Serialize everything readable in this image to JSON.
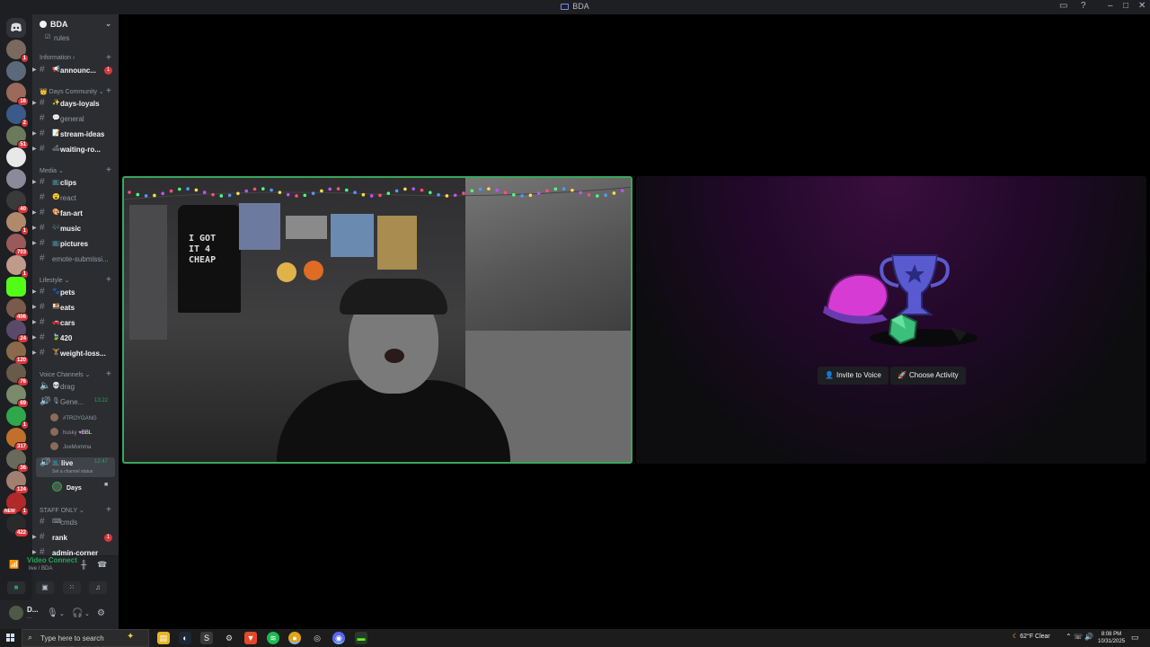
{
  "window": {
    "title": "BDA"
  },
  "server": {
    "name": "BDA"
  },
  "rail": {
    "servers": [
      {
        "name": "server-1",
        "badge": "1"
      },
      {
        "name": "server-2",
        "badge": ""
      },
      {
        "name": "server-3",
        "badge": "16"
      },
      {
        "name": "server-4",
        "badge": "2"
      },
      {
        "name": "server-5",
        "badge": "51"
      },
      {
        "name": "server-6",
        "badge": ""
      },
      {
        "name": "server-7",
        "badge": ""
      },
      {
        "name": "server-8",
        "badge": "40"
      },
      {
        "name": "server-9",
        "badge": "1"
      },
      {
        "name": "server-10",
        "badge": "703"
      },
      {
        "name": "server-11",
        "badge": "1"
      },
      {
        "name": "server-12",
        "badge": ""
      },
      {
        "name": "server-13",
        "badge": "406"
      },
      {
        "name": "server-14",
        "badge": "24"
      },
      {
        "name": "server-15",
        "badge": "120"
      },
      {
        "name": "server-16",
        "badge": "76"
      },
      {
        "name": "server-17",
        "badge": "69"
      },
      {
        "name": "server-18",
        "badge": "1"
      },
      {
        "name": "server-19",
        "badge": "317"
      },
      {
        "name": "server-20",
        "badge": "36"
      },
      {
        "name": "server-21",
        "badge": "124"
      },
      {
        "name": "server-22",
        "badge": "1"
      },
      {
        "name": "server-23",
        "badge": "422"
      }
    ],
    "new_label": "NEW"
  },
  "sidebar": {
    "top_channel": "rules",
    "categories": {
      "information": "Information",
      "days_community": "Days Community",
      "media": "Media",
      "lifestyle": "Lifestyle",
      "voice": "Voice Channels",
      "staff": "STAFF ONLY"
    },
    "channels": {
      "announcements": {
        "name": "announc...",
        "mentions": "1"
      },
      "days_loyals": {
        "name": "days-loyals"
      },
      "general": {
        "name": "general"
      },
      "stream_ideas": {
        "name": "stream-ideas"
      },
      "waiting_room": {
        "name": "waiting-ro..."
      },
      "clips": {
        "name": "clips"
      },
      "react": {
        "name": "react"
      },
      "fan_art": {
        "name": "fan-art"
      },
      "music": {
        "name": "music"
      },
      "pictures": {
        "name": "pictures"
      },
      "emote": {
        "name": "emote-submissi..."
      },
      "pets": {
        "name": "pets"
      },
      "eats": {
        "name": "eats"
      },
      "cars": {
        "name": "cars"
      },
      "c420": {
        "name": "420"
      },
      "weight_loss": {
        "name": "weight-loss..."
      },
      "cmds": {
        "name": "cmds"
      },
      "rank": {
        "name": "rank",
        "mentions": "1"
      },
      "admin_corner": {
        "name": "admin-corner"
      }
    },
    "voice_channels": {
      "drag": {
        "name": "drag"
      },
      "general": {
        "name": "Gene...",
        "timer": "13:22",
        "users": [
          "#TROYGANG",
          "husky",
          "JoeMomma"
        ],
        "husky_tag": "BBL"
      },
      "live": {
        "name": "live",
        "timer": "12:47",
        "status_hint": "Set a channel status",
        "users": [
          "Days"
        ]
      }
    }
  },
  "voice_panel": {
    "status": "Video Connected",
    "location": "live / BDA"
  },
  "user_panel": {
    "username": "D...",
    "status": "..."
  },
  "stage": {
    "shirt_text": "I GOT\nIT 4\nCHEAP",
    "invite_label": "Invite to Voice",
    "activity_label": "Choose Activity"
  },
  "taskbar": {
    "search_placeholder": "Type here to search",
    "weather": "62°F  Clear",
    "time": "8:08 PM",
    "date": "10/31/2025"
  }
}
